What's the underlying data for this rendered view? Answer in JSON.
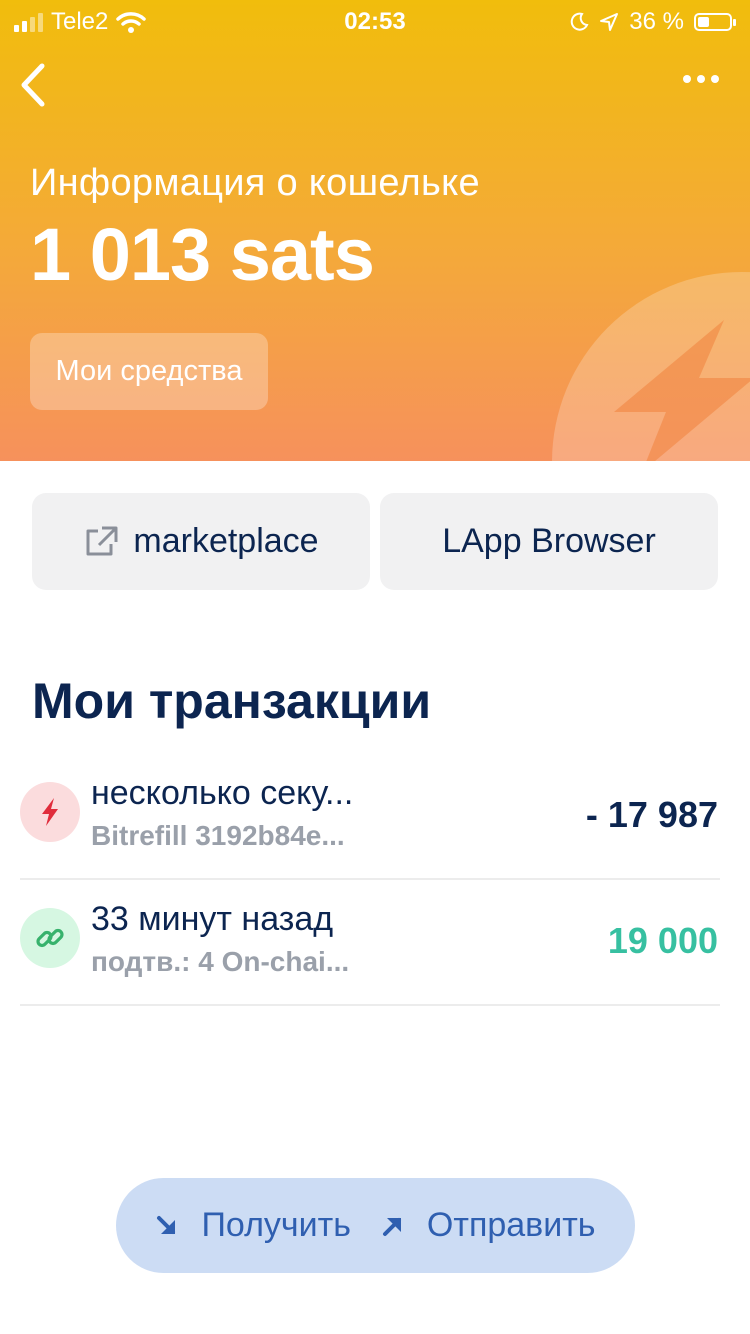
{
  "status_bar": {
    "carrier": "Tele2",
    "time": "02:53",
    "battery": "36 %",
    "battery_level": 0.36
  },
  "header": {
    "subtitle": "Информация о кошельке",
    "balance": "1 013 sats",
    "funds_button": "Мои средства"
  },
  "actions": {
    "marketplace": "marketplace",
    "lapp_browser": "LApp Browser"
  },
  "transactions": {
    "title": "Мои транзакции",
    "items": [
      {
        "title": "несколько секу...",
        "memo": "Bitrefill 3192b84e...",
        "amount": "- 17 987",
        "icon": "lightning-icon",
        "color": "#0c2550"
      },
      {
        "title": "33 минут назад",
        "memo": "подтв.: 4 On-chai...",
        "amount": "19 000",
        "icon": "chain-link-icon",
        "color": "#37c0a1"
      }
    ]
  },
  "bottom_bar": {
    "receive": "Получить",
    "send": "Отправить"
  },
  "colors": {
    "header_top": "#f1bd0c",
    "header_bottom": "#f6915c",
    "primary_text": "#0c2550",
    "accent_blue": "#2f5fb0",
    "positive": "#37c0a1"
  }
}
